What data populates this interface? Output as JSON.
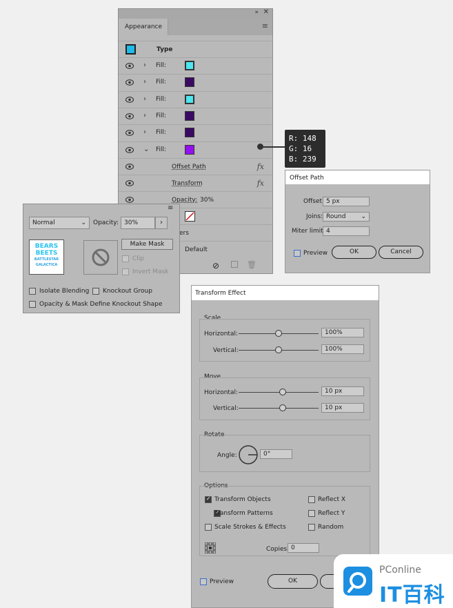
{
  "appearance": {
    "title": "Appearance",
    "header_label": "Type",
    "rows": [
      {
        "label": "Fill:",
        "color": "#4ee6f0"
      },
      {
        "label": "Fill:",
        "color": "#3a0a63"
      },
      {
        "label": "Fill:",
        "color": "#4ee6f0"
      },
      {
        "label": "Fill:",
        "color": "#3a0a63"
      },
      {
        "label": "Fill:",
        "color": "#3a0a63"
      },
      {
        "label": "Fill:",
        "color": "#9410ef"
      }
    ],
    "effects": [
      {
        "label": "Offset Path",
        "icon": "fx"
      },
      {
        "label": "Transform",
        "icon": "fx"
      }
    ],
    "opacity_label": "Opacity:",
    "opacity_value": "30%",
    "characters_label": "ers",
    "default_label": "Default"
  },
  "color_tooltip": {
    "r": "R: 148",
    "g": "G: 16",
    "b": "B: 239"
  },
  "transparency": {
    "blend_mode": "Normal",
    "opacity_label": "Opacity:",
    "opacity_value": "30%",
    "thumb_lines": [
      "BEARS",
      "BEETS",
      "BATTLESTAR",
      "GALACTICA"
    ],
    "make_mask": "Make Mask",
    "clip": "Clip",
    "invert_mask": "Invert Mask",
    "isolate_blending": "Isolate Blending",
    "knockout_group": "Knockout Group",
    "opacity_mask_knockout": "Opacity & Mask Define Knockout Shape"
  },
  "offset_path": {
    "title": "Offset Path",
    "offset_label": "Offset:",
    "offset_value": "5 px",
    "joins_label": "Joins:",
    "joins_value": "Round",
    "miter_label": "Miter limit:",
    "miter_value": "4",
    "preview": "Preview",
    "ok": "OK",
    "cancel": "Cancel"
  },
  "transform": {
    "title": "Transform Effect",
    "scale_label": "Scale",
    "horizontal": "Horizontal:",
    "vertical": "Vertical:",
    "scale_h": "100%",
    "scale_v": "100%",
    "move_label": "Move",
    "move_h": "10 px",
    "move_v": "10 px",
    "rotate_label": "Rotate",
    "angle_label": "Angle:",
    "angle_value": "0°",
    "options_label": "Options",
    "transform_objects": "Transform Objects",
    "transform_patterns": "Transform Patterns",
    "scale_strokes": "Scale Strokes & Effects",
    "reflect_x": "Reflect X",
    "reflect_y": "Reflect Y",
    "random": "Random",
    "copies_label": "Copies",
    "copies_value": "0",
    "preview": "Preview",
    "ok": "OK"
  },
  "watermark": {
    "brand_top": "PConline",
    "brand_bottom": "IT百科"
  }
}
